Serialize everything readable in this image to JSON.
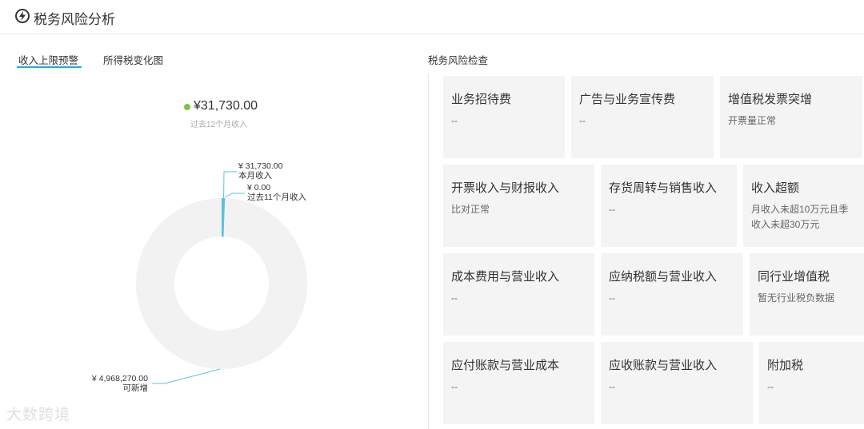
{
  "header": {
    "title": "税务风险分析",
    "icon": "lightning-circle-icon"
  },
  "tabs": [
    {
      "label": "收入上限预警",
      "active": true
    },
    {
      "label": "所得税变化图",
      "active": false
    }
  ],
  "income": {
    "total_value": "¥31,730.00",
    "total_caption": "过去12个月收入",
    "legend_color": "#7cc540",
    "segments": [
      {
        "value_label": "¥ 31,730.00",
        "name": "本月收入",
        "value": 31730,
        "color": "#5bc0de"
      },
      {
        "value_label": "¥ 0.00",
        "name": "过去11个月收入",
        "value": 0,
        "color": "#5bc0de"
      },
      {
        "value_label": "¥ 4,968,270.00",
        "name": "可新增",
        "value": 4968270,
        "color": "#f2f2f2"
      }
    ]
  },
  "risk": {
    "title": "税务风险检查",
    "cards": [
      {
        "name": "业务招待费",
        "desc": "--"
      },
      {
        "name": "广告与业务宣传费",
        "desc": "--"
      },
      {
        "name": "增值税发票突增",
        "desc": "开票量正常"
      },
      {
        "name": "开票收入与财报收入",
        "desc": "比对正常"
      },
      {
        "name": "存货周转与销售收入",
        "desc": "--"
      },
      {
        "name": "收入超额",
        "desc": "月收入未超10万元且季收入未超30万元"
      },
      {
        "name": "成本费用与营业收入",
        "desc": "--"
      },
      {
        "name": "应纳税额与营业收入",
        "desc": "--"
      },
      {
        "name": "同行业增值税",
        "desc": "暂无行业税负数据"
      },
      {
        "name": "应付账款与营业成本",
        "desc": "--"
      },
      {
        "name": "应收账款与营业收入",
        "desc": "--"
      },
      {
        "name": "附加税",
        "desc": "--"
      }
    ]
  },
  "watermark": "大数跨境"
}
